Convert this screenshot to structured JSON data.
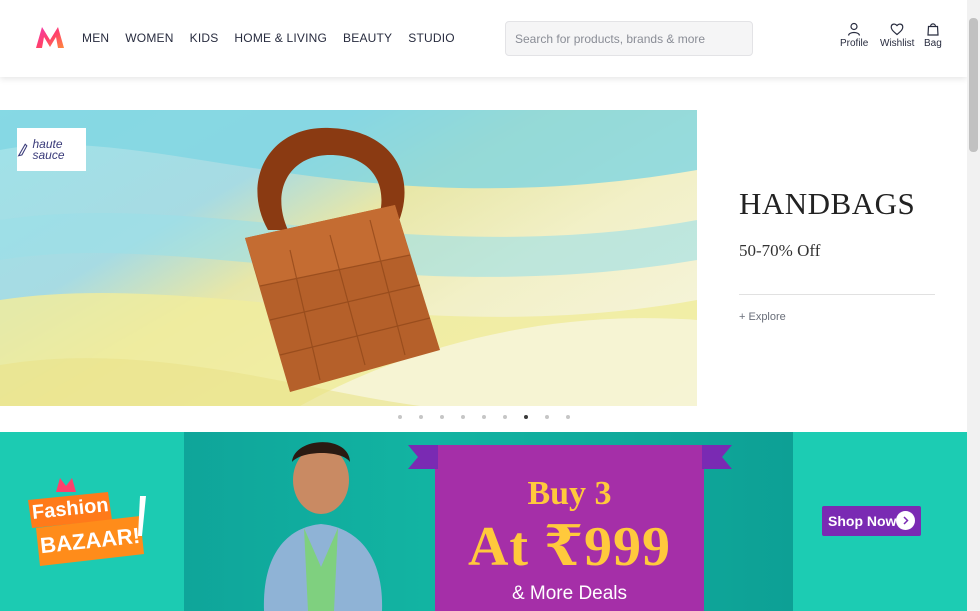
{
  "header": {
    "logo": "myntra-logo-icon",
    "nav": [
      "MEN",
      "WOMEN",
      "KIDS",
      "HOME & LIVING",
      "BEAUTY",
      "STUDIO"
    ],
    "search_placeholder": "Search for products, brands & more",
    "actions": {
      "profile": "Profile",
      "wishlist": "Wishlist",
      "bag": "Bag"
    }
  },
  "hero": {
    "brand": "haute sauce",
    "title": "HANDBAGS",
    "subtitle": "50-70% Off",
    "explore": "+ Explore",
    "carousel_count": 9,
    "carousel_active": 6
  },
  "promo": {
    "badge_line1": "Fashion",
    "badge_line2": "BAZAAR!",
    "headline": "Buy 3",
    "price": "At ₹999",
    "deals": "& More Deals",
    "cta": "Shop Now"
  },
  "colors": {
    "brand_accent": "#ff3f6c",
    "promo_teal": "#18c8b0",
    "promo_purple": "#a52fa8",
    "promo_gold": "#ffc93c",
    "cta_purple": "#7a2ab3"
  }
}
